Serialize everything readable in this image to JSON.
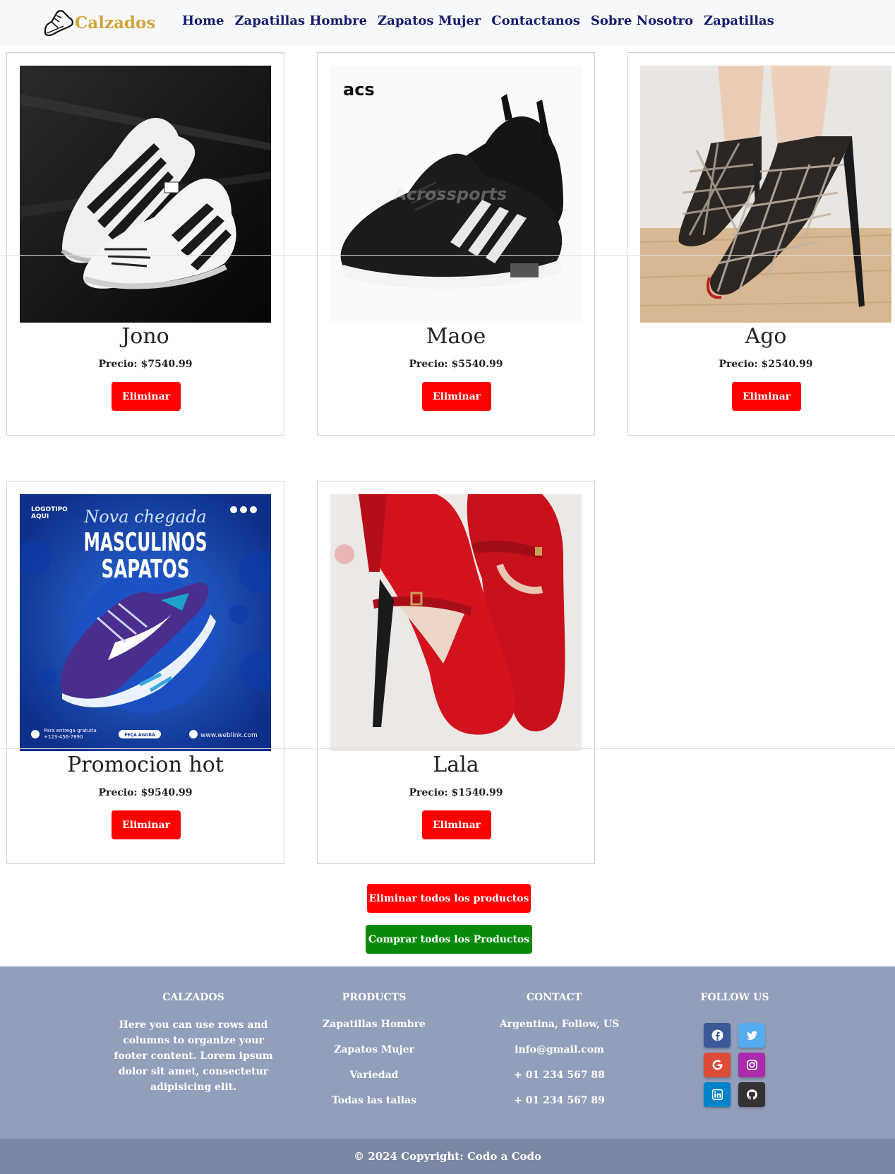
{
  "nav": {
    "brand": "Calzados",
    "links": [
      "Home",
      "Zapatillas Hombre",
      "Zapatos Mujer",
      "Contactanos",
      "Sobre Nosotro",
      "Zapatillas"
    ]
  },
  "products": [
    {
      "name": "Jono",
      "price": "Precio: $7540.99",
      "button": "Eliminar",
      "image": "white-sneakers-image"
    },
    {
      "name": "Maoe",
      "price": "Precio: $5540.99",
      "button": "Eliminar",
      "image": "black-sneakers-image"
    },
    {
      "name": "Ago",
      "price": "Precio: $2540.99",
      "button": "Eliminar",
      "image": "cage-heels-image"
    },
    {
      "name": "Promocion hot",
      "price": "Precio: $9540.99",
      "button": "Eliminar",
      "image": "promo-sneaker-image"
    },
    {
      "name": "Lala",
      "price": "Precio: $1540.99",
      "button": "Eliminar",
      "image": "red-heels-image"
    }
  ],
  "images": {
    "acs_logo": "acs",
    "promo": {
      "logo": "LOGOTIPO\nAQUI",
      "script": "Nova chegada",
      "line1": "MASCULINOS",
      "line2": "SAPATOS",
      "delivery": "Para entrega gratuita",
      "phone": "+123-456-7890",
      "cta": "PEÇA AGORA",
      "web": "www.weblink.com"
    }
  },
  "actions": {
    "delete_all": "Eliminar todos los productos",
    "buy_all": "Comprar todos los Productos"
  },
  "footer": {
    "calzados": {
      "title": "CALZADOS",
      "text": "Here you can use rows and columns to organize your footer content. Lorem ipsum dolor sit amet, consectetur adipisicing elit."
    },
    "products": {
      "title": "PRODUCTS",
      "items": [
        "Zapatillas Hombre",
        "Zapatos Mujer",
        "Variedad",
        "Todas las tallas"
      ]
    },
    "contact": {
      "title": "CONTACT",
      "items": [
        "Argentina, Follow, US",
        "info@gmail.com",
        "+ 01 234 567 88",
        "+ 01 234 567 89"
      ]
    },
    "follow": {
      "title": "FOLLOW US",
      "icons": [
        "facebook-icon",
        "twitter-icon",
        "google-icon",
        "instagram-icon",
        "linkedin-icon",
        "github-icon"
      ]
    },
    "copyright": "© 2024 Copyright: Codo a Codo"
  },
  "colors": {
    "brand": "#d4a43a",
    "nav_link": "#161a6c",
    "delete": "#fe0000",
    "buy": "#0a8a0a",
    "footer_bg": "#929fbb",
    "copyright_bg": "#7b87a2"
  }
}
